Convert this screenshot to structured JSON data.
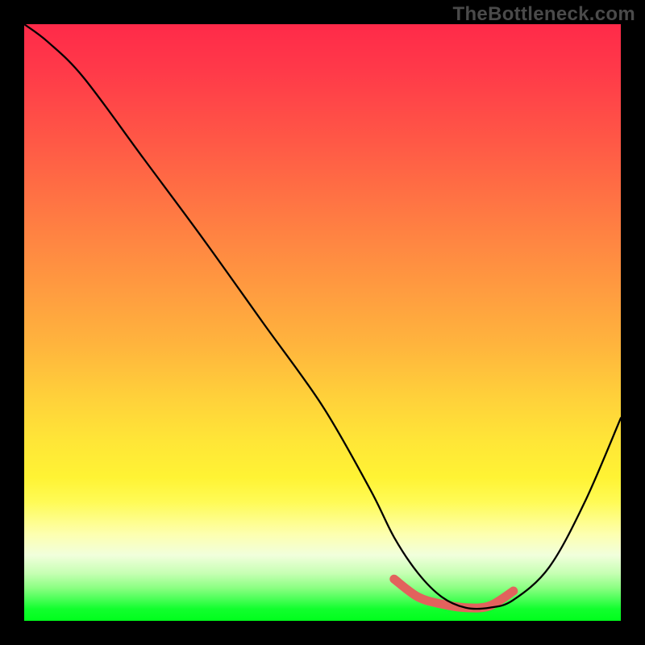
{
  "watermark": "TheBottleneck.com",
  "colors": {
    "curve": "#000000",
    "highlight": "#e2625d",
    "gradient_top": "#ff2a49",
    "gradient_bottom": "#00ff1c"
  },
  "chart_data": {
    "type": "line",
    "title": "",
    "xlabel": "",
    "ylabel": "",
    "xlim": [
      0,
      100
    ],
    "ylim": [
      0,
      100
    ],
    "series": [
      {
        "name": "bottleneck-curve",
        "x": [
          0,
          4,
          10,
          20,
          30,
          40,
          50,
          58,
          62,
          66,
          70,
          74,
          78,
          82,
          88,
          94,
          100
        ],
        "y": [
          100,
          97,
          91,
          77.5,
          64,
          50,
          36,
          22,
          14,
          8,
          4,
          2.2,
          2.2,
          3.5,
          9,
          20,
          34
        ]
      }
    ],
    "highlight_segment": {
      "name": "optimal-range",
      "x": [
        62,
        66,
        70,
        74,
        78,
        82
      ],
      "y": [
        7.0,
        4.0,
        2.8,
        2.2,
        2.5,
        5.0
      ]
    }
  }
}
